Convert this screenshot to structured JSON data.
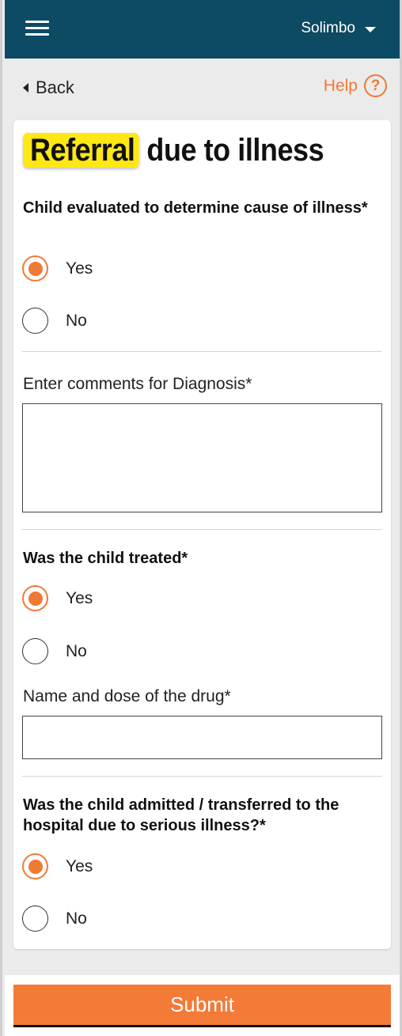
{
  "header": {
    "user_name": "Solimbo",
    "menu_icon": "hamburger-menu-icon",
    "dropdown_icon": "caret-down-icon"
  },
  "nav": {
    "back_label": "Back",
    "help_label": "Help",
    "help_icon_glyph": "?"
  },
  "form": {
    "title_highlight": "Referral",
    "title_rest": " due to illness",
    "q1": {
      "label": "Child evaluated to determine cause of illness*",
      "options": [
        "Yes",
        "No"
      ],
      "selected": "Yes"
    },
    "diagnosis": {
      "label": "Enter comments for Diagnosis*",
      "value": "",
      "placeholder": ""
    },
    "q2": {
      "label": "Was the child treated*",
      "options": [
        "Yes",
        "No"
      ],
      "selected": "Yes"
    },
    "drug": {
      "label": "Name and dose of the drug*",
      "value": "",
      "placeholder": ""
    },
    "q3": {
      "label": "Was the child admitted / transferred to the hospital due to serious illness?*",
      "options": [
        "Yes",
        "No"
      ],
      "selected": "Yes"
    }
  },
  "footer": {
    "submit_label": "Submit"
  },
  "colors": {
    "header_bg": "#0d4a63",
    "accent": "#f07a35",
    "highlight": "#ffe716",
    "submit_bg": "#f47a38"
  }
}
